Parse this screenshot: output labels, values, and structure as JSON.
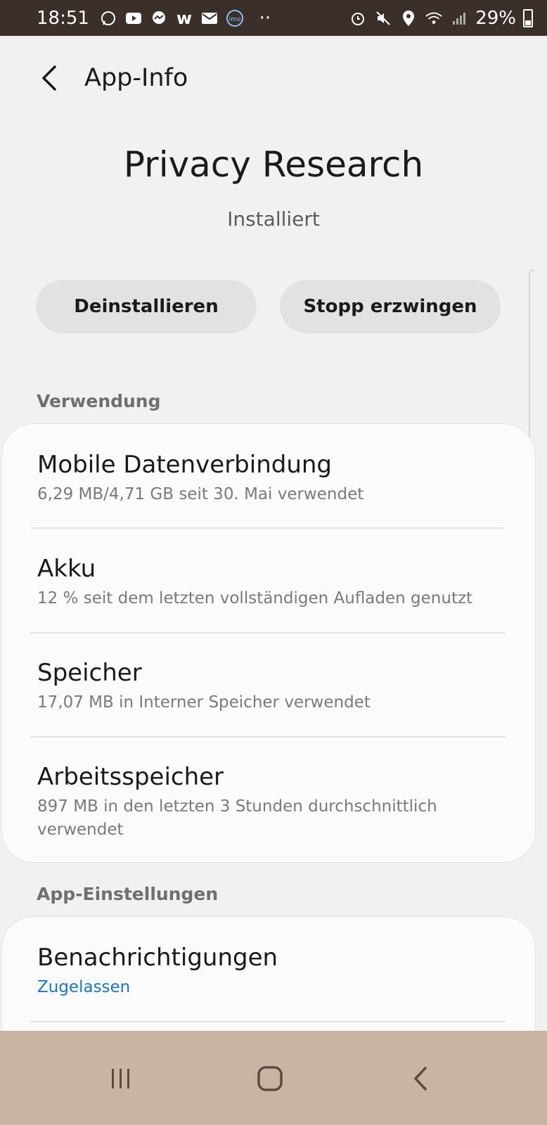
{
  "status_bar": {
    "time": "18:51",
    "left_icons": [
      "whatsapp-icon",
      "youtube-icon",
      "messenger-icon",
      "w-app-icon",
      "mail-icon",
      "imo-icon",
      "more-dots-icon"
    ],
    "right_icons": [
      "alarm-icon",
      "mute-icon",
      "location-icon",
      "wifi-icon",
      "signal-icon"
    ],
    "battery": "29%"
  },
  "appbar": {
    "title": "App-Info"
  },
  "app": {
    "name": "Privacy Research",
    "status": "Installiert"
  },
  "actions": {
    "uninstall": "Deinstallieren",
    "force_stop": "Stopp erzwingen"
  },
  "sections": {
    "usage_header": "Verwendung",
    "usage_items": [
      {
        "title": "Mobile Datenverbindung",
        "subtitle": "6,29 MB/4,71 GB seit 30. Mai verwendet"
      },
      {
        "title": "Akku",
        "subtitle": "12 % seit dem letzten vollständigen Aufladen genutzt"
      },
      {
        "title": "Speicher",
        "subtitle": "17,07 MB in Interner Speicher verwendet"
      },
      {
        "title": "Arbeitsspeicher",
        "subtitle": "897 MB in den letzten 3 Stunden durchschnittlich verwendet"
      }
    ],
    "settings_header": "App-Einstellungen",
    "settings_items": [
      {
        "title": "Benachrichtigungen",
        "subtitle": "Zugelassen"
      }
    ]
  },
  "colors": {
    "status_bar": "#3b2f2a",
    "nav_bar": "#c9b4a3",
    "accent": "#1976c7"
  }
}
